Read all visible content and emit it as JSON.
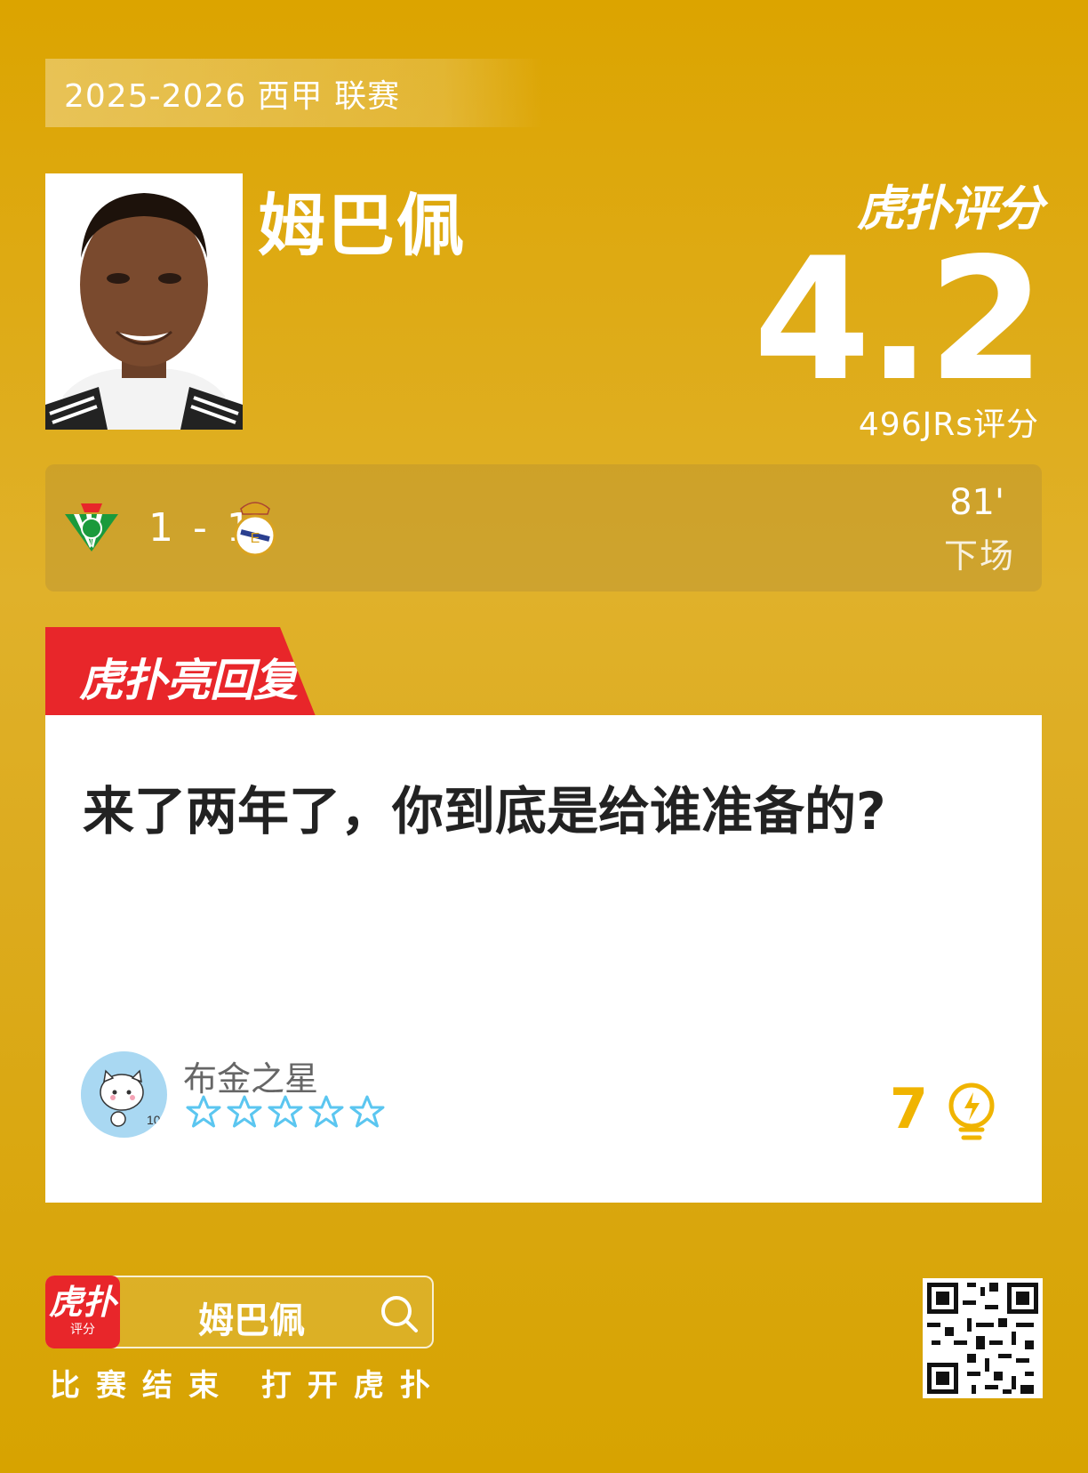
{
  "league": "2025-2026 西甲 联赛",
  "player": {
    "name": "姆巴佩"
  },
  "rating": {
    "brand": "虎扑评分",
    "score": "4.2",
    "votes": "496JRs评分"
  },
  "match": {
    "score": "1 - 1",
    "minute": "81'",
    "status": "下场"
  },
  "hot_reply": {
    "tab_label": "虎扑亮回复",
    "comment": "来了两年了，你到底是给谁准备的?",
    "user": "布金之星",
    "stars": 0,
    "likes": "7"
  },
  "footer": {
    "app_icon_big": "虎扑",
    "app_icon_small": "评分",
    "search_text": "姆巴佩",
    "cta": "比赛结束 打开虎扑"
  },
  "colors": {
    "accent": "#e8262a",
    "background": "#dca400",
    "like": "#f0b400"
  },
  "icons": [
    "search-icon",
    "star-icon",
    "lightbulb-icon",
    "qr-code"
  ]
}
